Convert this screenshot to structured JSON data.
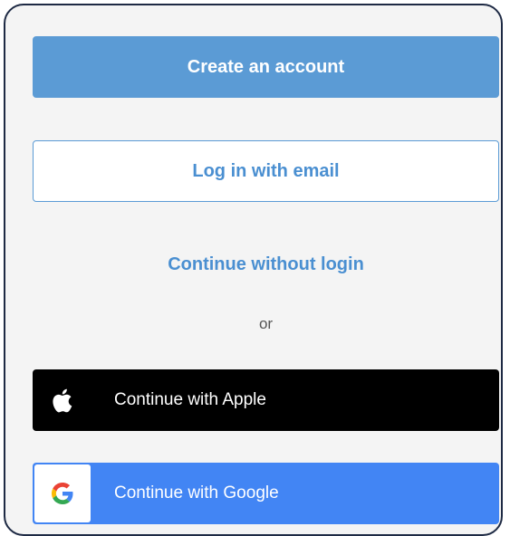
{
  "buttons": {
    "create_account": "Create an account",
    "login_email": "Log in with email",
    "continue_without_login": "Continue without login",
    "or": "or",
    "apple": "Continue with Apple",
    "google": "Continue with Google"
  },
  "icons": {
    "apple": "apple-logo-icon",
    "google": "google-logo-icon"
  },
  "colors": {
    "primary": "#5b9bd5",
    "link": "#4a8fd1",
    "apple_bg": "#000000",
    "google_bg": "#4285f4",
    "frame_border": "#1e2a44"
  }
}
